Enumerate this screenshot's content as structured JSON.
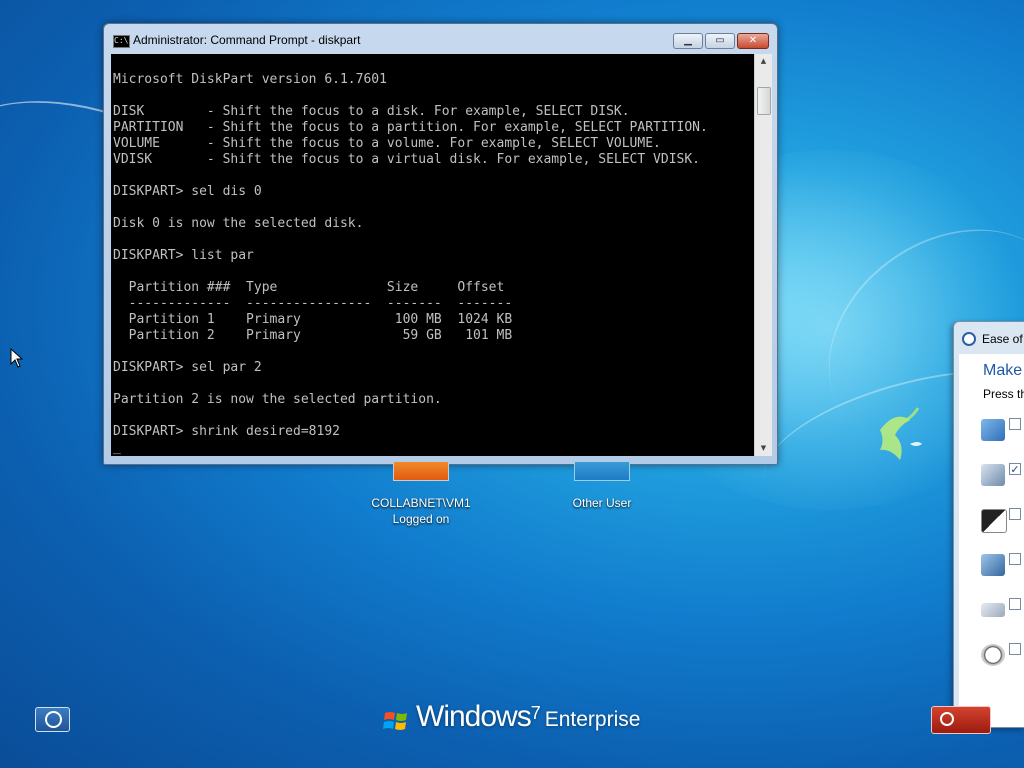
{
  "cmd_window": {
    "title": "Administrator:  Command Prompt - diskpart",
    "icon": "console-icon",
    "buttons": {
      "minimize": "minimize-icon",
      "maximize": "maximize-icon",
      "close": "close-icon"
    },
    "console_text": "Microsoft DiskPart version 6.1.7601\n\nDISK        - Shift the focus to a disk. For example, SELECT DISK.\nPARTITION   - Shift the focus to a partition. For example, SELECT PARTITION.\nVOLUME      - Shift the focus to a volume. For example, SELECT VOLUME.\nVDISK       - Shift the focus to a virtual disk. For example, SELECT VDISK.\n\nDISKPART> sel dis 0\n\nDisk 0 is now the selected disk.\n\nDISKPART> list par\n\n  Partition ###  Type              Size     Offset\n  -------------  ----------------  -------  -------\n  Partition 1    Primary            100 MB  1024 KB\n  Partition 2    Primary             59 GB   101 MB\n\nDISKPART> sel par 2\n\nPartition 2 is now the selected partition.\n\nDISKPART> shrink desired=8192\n_",
    "text_color": "#c0c0c0",
    "background": "#000000"
  },
  "users": [
    {
      "name_line1": "COLLABNET\\VM1",
      "name_line2": "Logged on"
    },
    {
      "name_line1": "Other User",
      "name_line2": ""
    }
  ],
  "ease_panel": {
    "title": "Ease of A",
    "heading": "Make",
    "subtext": "Press th",
    "options": [
      {
        "icon": "narrator-icon",
        "checked": false
      },
      {
        "icon": "magnifier-icon",
        "checked": true
      },
      {
        "icon": "high-contrast-icon",
        "checked": false
      },
      {
        "icon": "on-screen-keyboard-icon",
        "checked": false
      },
      {
        "icon": "sticky-keys-icon",
        "checked": false
      },
      {
        "icon": "filter-keys-icon",
        "checked": false
      }
    ]
  },
  "brand": {
    "name": "Windows",
    "version": "7",
    "edition": "Enterprise"
  },
  "bottom_bar": {
    "ease_of_access_icon": "ease-of-access-icon",
    "shutdown_icon": "power-icon"
  },
  "colors": {
    "accent": "#1e5aa8",
    "shutdown": "#c0301f",
    "desktop": "#117ccd"
  }
}
